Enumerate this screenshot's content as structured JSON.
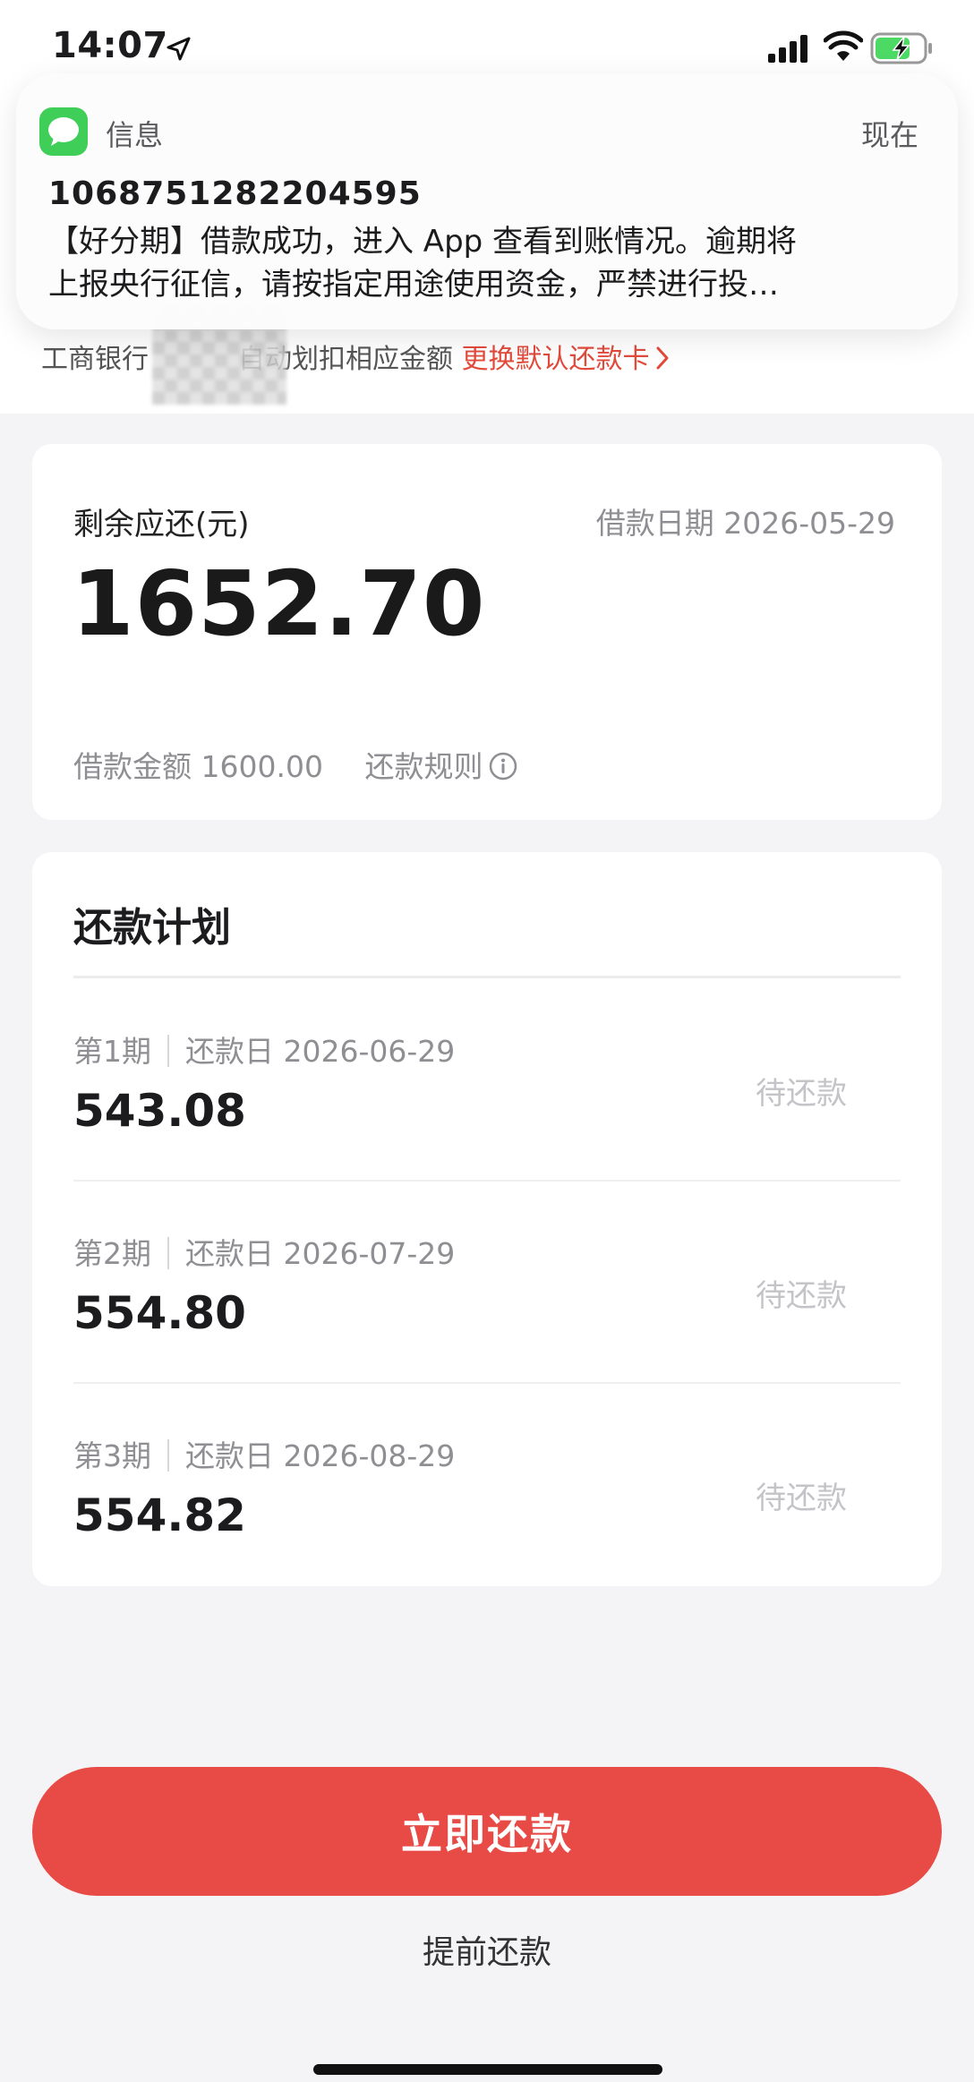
{
  "status_bar": {
    "time": "14:07",
    "icons": [
      "location-arrow-icon",
      "cellular-signal-icon",
      "wifi-icon",
      "battery-charging-icon"
    ]
  },
  "notification": {
    "app_name": "信息",
    "time": "现在",
    "sender": "1068751282204595",
    "body_line1": "【好分期】借款成功，进入 App 查看到账情况。逾期将",
    "body_line2": "上报央行征信，请按指定用途使用资金，严禁进行投…",
    "app_icon": "messages-icon",
    "app_icon_color": "#3fce58"
  },
  "bank_line": {
    "prefix": "工商银行",
    "suffix": "自动划扣相应金额",
    "link": "更换默认还款卡"
  },
  "summary": {
    "remaining_label": "剩余应还(元)",
    "loan_date": "借款日期 2026-05-29",
    "remaining_amount": "1652.70",
    "loan_amount": "借款金额 1600.00",
    "rules_link": "还款规则"
  },
  "plan": {
    "title": "还款计划",
    "items": [
      {
        "period": "第1期",
        "due": "还款日 2026-06-29",
        "amount": "543.08",
        "status": "待还款"
      },
      {
        "period": "第2期",
        "due": "还款日 2026-07-29",
        "amount": "554.80",
        "status": "待还款"
      },
      {
        "period": "第3期",
        "due": "还款日 2026-08-29",
        "amount": "554.82",
        "status": "待还款"
      }
    ]
  },
  "actions": {
    "pay_now": "立即还款",
    "prepay": "提前还款"
  },
  "colors": {
    "accent": "#e84a45",
    "link_red": "#e24a3c",
    "muted_text": "#8e8e93",
    "page_background": "#f4f4f6"
  }
}
